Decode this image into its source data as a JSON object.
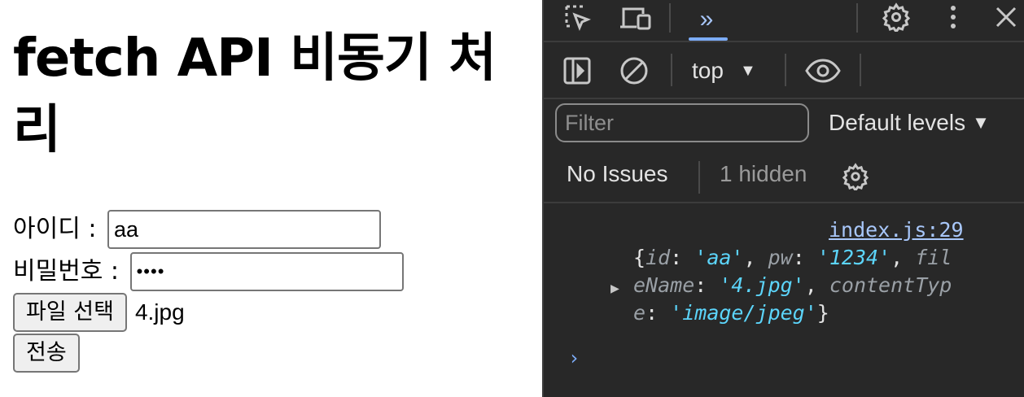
{
  "page": {
    "title": "fetch API 비동기 처리",
    "id_label": "아이디 : ",
    "id_value": "aa",
    "pw_label": "비밀번호 : ",
    "pw_masked": "••••",
    "file_button": "파일 선택",
    "file_name": "4.jpg",
    "submit_button": "전송"
  },
  "devtools": {
    "more_tabs": "»",
    "context": "top",
    "filter_placeholder": "Filter",
    "levels": "Default levels",
    "no_issues": "No Issues",
    "hidden": "1 hidden",
    "log": {
      "source": "index.js:29",
      "line1_open": "{",
      "k_id": "id",
      "v_id": "'aa'",
      "k_pw": "pw",
      "v_pw": "'1234'",
      "k_fil": "fil",
      "k_ename": "eName",
      "v_ename": "'4.jpg'",
      "k_contenttyp": "contentTyp",
      "k_e": "e",
      "v_e": "'image/jpeg'",
      "line3_close": "}"
    },
    "accent_color": "#7cacf8",
    "string_color": "#5cd5fb"
  }
}
